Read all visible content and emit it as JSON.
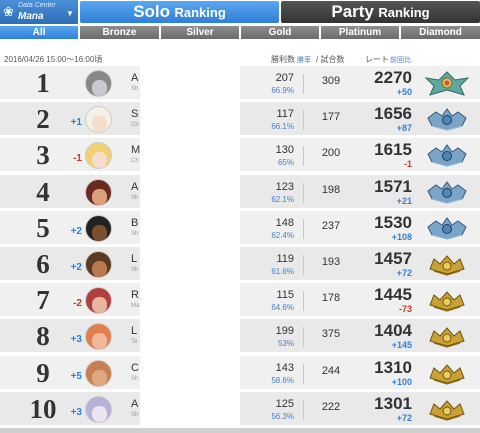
{
  "header": {
    "datacenter_label": "Data Center",
    "datacenter_name": "Mana",
    "solo_big": "Solo",
    "solo_small": "Ranking",
    "party_big": "Party",
    "party_small": "Ranking"
  },
  "tiers": [
    "All",
    "Bronze",
    "Silver",
    "Gold",
    "Platinum",
    "Diamond"
  ],
  "active_tier": "All",
  "meta": {
    "date": "2016/04/26 15:00〜16:00頃",
    "wins_header": "勝利数",
    "winrate_header": "勝率",
    "matches_header": "/ 試合数",
    "rating_header": "レート",
    "prev_header": "前回比"
  },
  "colors": {
    "accent": "#2f7fd6",
    "up": "#2f80d8",
    "down": "#c0392b",
    "row_bg": "#f0f0f0"
  },
  "rows": [
    {
      "rank": "1",
      "change": "",
      "dir": "none",
      "initial": "A",
      "sub": "Sh",
      "wins": "207",
      "winpct": "66.9%",
      "matches": "309",
      "rating": "2270",
      "delta": "+50",
      "emblem": "diamond-emblem-icon",
      "skin": "#c8c8d0",
      "hair": "#888"
    },
    {
      "rank": "2",
      "change": "+1",
      "dir": "up",
      "initial": "S",
      "sub": "Ch",
      "wins": "117",
      "winpct": "66.1%",
      "matches": "177",
      "rating": "1656",
      "delta": "+87",
      "emblem": "platinum-emblem-icon",
      "skin": "#f6dccb",
      "hair": "#f4f0e8"
    },
    {
      "rank": "3",
      "change": "-1",
      "dir": "down",
      "initial": "M",
      "sub": "Ch",
      "wins": "130",
      "winpct": "65%",
      "matches": "200",
      "rating": "1615",
      "delta": "-1",
      "emblem": "platinum-emblem-icon",
      "skin": "#f6dccb",
      "hair": "#f0d070"
    },
    {
      "rank": "4",
      "change": "",
      "dir": "none",
      "initial": "A",
      "sub": "Sh",
      "wins": "123",
      "winpct": "62.1%",
      "matches": "198",
      "rating": "1571",
      "delta": "+21",
      "emblem": "platinum-emblem-icon",
      "skin": "#d9a07a",
      "hair": "#6a2a20"
    },
    {
      "rank": "5",
      "change": "+2",
      "dir": "up",
      "initial": "B",
      "sub": "Sh",
      "wins": "148",
      "winpct": "62.4%",
      "matches": "237",
      "rating": "1530",
      "delta": "+108",
      "emblem": "platinum-emblem-icon",
      "skin": "#7a5030",
      "hair": "#222"
    },
    {
      "rank": "6",
      "change": "+2",
      "dir": "up",
      "initial": "L",
      "sub": "Sh",
      "wins": "119",
      "winpct": "61.6%",
      "matches": "193",
      "rating": "1457",
      "delta": "+72",
      "emblem": "gold-emblem-icon",
      "skin": "#b77a50",
      "hair": "#5a3a20"
    },
    {
      "rank": "7",
      "change": "-2",
      "dir": "down",
      "initial": "R",
      "sub": "Ma",
      "wins": "115",
      "winpct": "64.6%",
      "matches": "178",
      "rating": "1445",
      "delta": "-73",
      "emblem": "gold-emblem-icon",
      "skin": "#e9b7a0",
      "hair": "#b04040"
    },
    {
      "rank": "8",
      "change": "+3",
      "dir": "up",
      "initial": "L",
      "sub": "Te",
      "wins": "199",
      "winpct": "53%",
      "matches": "375",
      "rating": "1404",
      "delta": "+145",
      "emblem": "gold-emblem-icon",
      "skin": "#f0b898",
      "hair": "#e08050"
    },
    {
      "rank": "9",
      "change": "+5",
      "dir": "up",
      "initial": "C",
      "sub": "Sh",
      "wins": "143",
      "winpct": "58.6%",
      "matches": "244",
      "rating": "1310",
      "delta": "+100",
      "emblem": "gold-emblem-icon",
      "skin": "#e0a880",
      "hair": "#c88050"
    },
    {
      "rank": "10",
      "change": "+3",
      "dir": "up",
      "initial": "A",
      "sub": "Sh",
      "wins": "125",
      "winpct": "56.3%",
      "matches": "222",
      "rating": "1301",
      "delta": "+72",
      "emblem": "gold-emblem-icon",
      "skin": "#ece4f0",
      "hair": "#b8b0d8"
    }
  ]
}
